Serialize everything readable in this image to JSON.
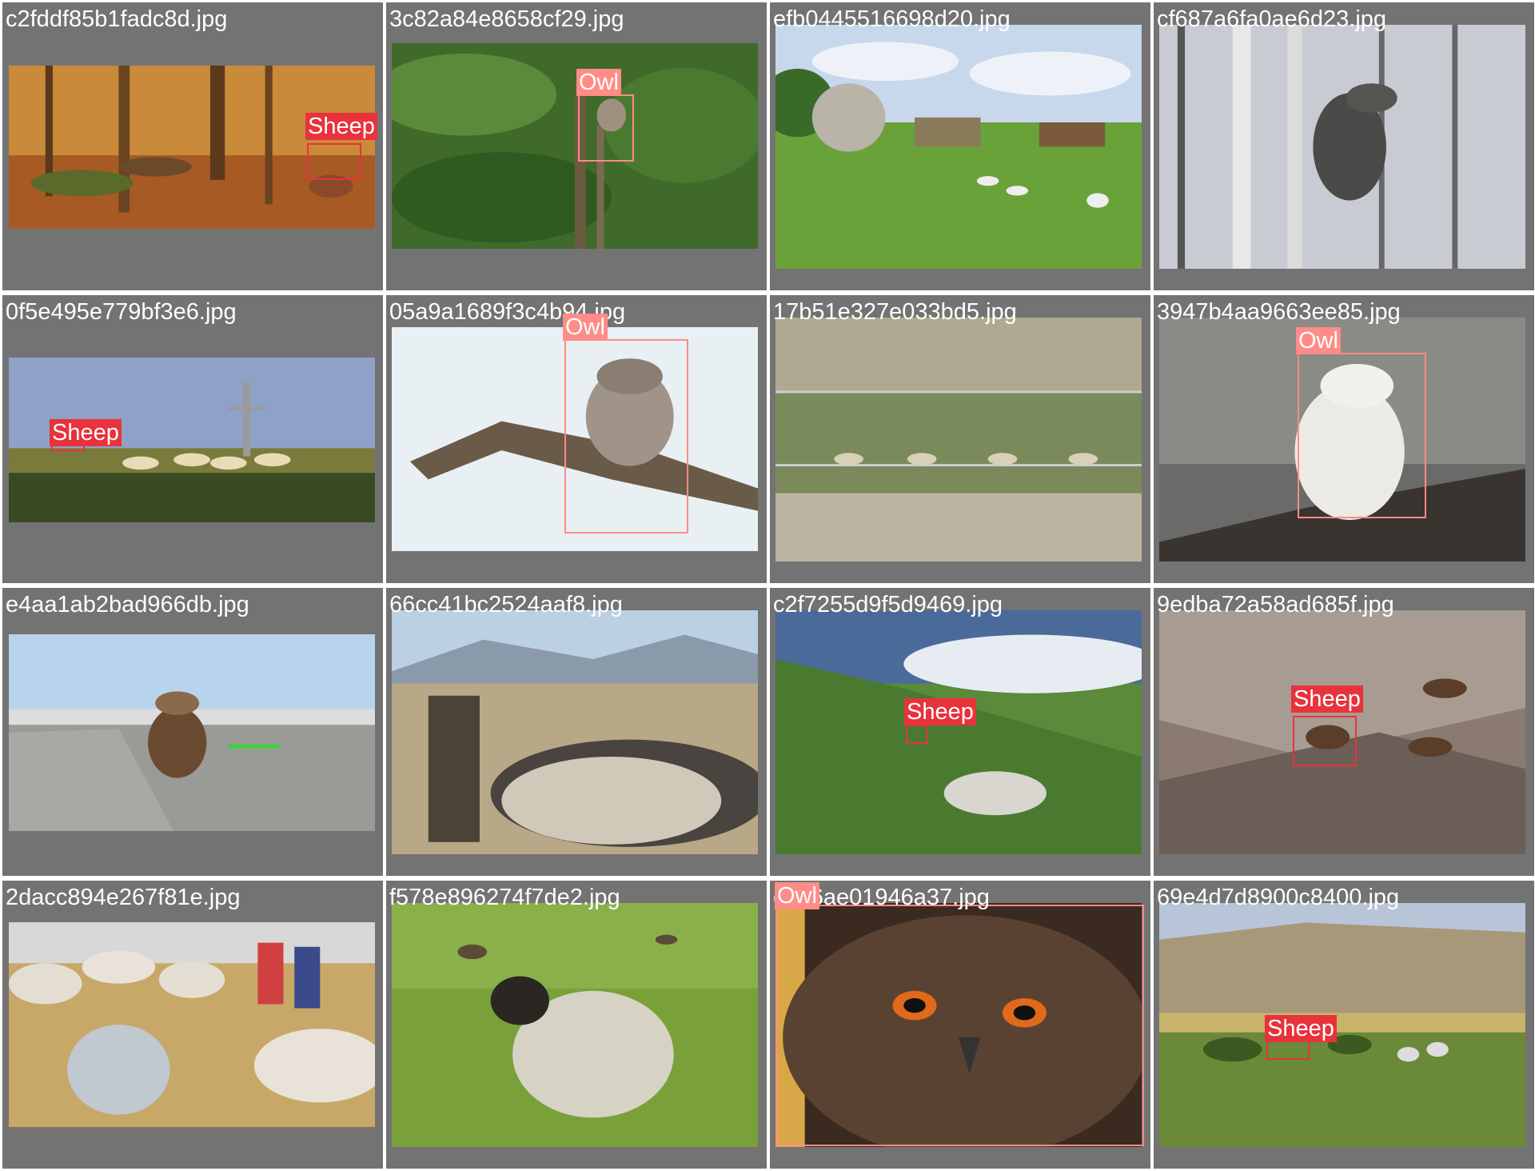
{
  "tiles": [
    {
      "filename": "c2fddf85b1fadc8d.jpg",
      "label": "Sheep",
      "label_class": "Sheep",
      "scene": "autumn-forest"
    },
    {
      "filename": "3c82a84e8658cf29.jpg",
      "label": "Owl",
      "label_class": "Owl",
      "scene": "green-tree-owl"
    },
    {
      "filename": "efb0445516698d20.jpg",
      "label": "",
      "label_class": "",
      "scene": "meadow-cottages"
    },
    {
      "filename": "cf687a6fa0ae6d23.jpg",
      "label": "",
      "label_class": "",
      "scene": "owl-bare-birch"
    },
    {
      "filename": "0f5e495e779bf3e6.jpg",
      "label": "Sheep",
      "label_class": "Sheep",
      "scene": "hill-cross-flock"
    },
    {
      "filename": "05a9a1689f3c4b94.jpg",
      "label": "Owl",
      "label_class": "Owl",
      "scene": "owl-on-branch"
    },
    {
      "filename": "17b51e327e033bd5.jpg",
      "label": "",
      "label_class": "",
      "scene": "fenced-flock"
    },
    {
      "filename": "3947b4aa9663ee85.jpg",
      "label": "Owl",
      "label_class": "Owl",
      "scene": "snowy-owl-cage"
    },
    {
      "filename": "e4aa1ab2bad966db.jpg",
      "label": "",
      "label_class": "",
      "scene": "owl-mascot-road"
    },
    {
      "filename": "66cc41bc2524aaf8.jpg",
      "label": "",
      "label_class": "",
      "scene": "livestock-market"
    },
    {
      "filename": "c2f7255d9f5d9469.jpg",
      "label": "Sheep",
      "label_class": "Sheep",
      "scene": "misty-valley-sheep"
    },
    {
      "filename": "9edba72a58ad685f.jpg",
      "label": "Sheep",
      "label_class": "Sheep",
      "scene": "bighorn-rocks"
    },
    {
      "filename": "2dacc894e267f81e.jpg",
      "label": "",
      "label_class": "",
      "scene": "barn-children-sheep"
    },
    {
      "filename": "f578e896274f7de2.jpg",
      "label": "",
      "label_class": "",
      "scene": "ram-in-grass"
    },
    {
      "filename": "c056ae01946a37.jpg",
      "label": "Owl",
      "label_class": "Owl",
      "scene": "owl-closeup"
    },
    {
      "filename": "69e4d7d8900c8400.jpg",
      "label": "Sheep",
      "label_class": "Sheep",
      "scene": "savanna-sheep"
    }
  ],
  "colors": {
    "tile_background": "#737373",
    "sheep_box": "#e8323c",
    "owl_box": "#ff8c86",
    "caption_text": "#ffffff"
  }
}
